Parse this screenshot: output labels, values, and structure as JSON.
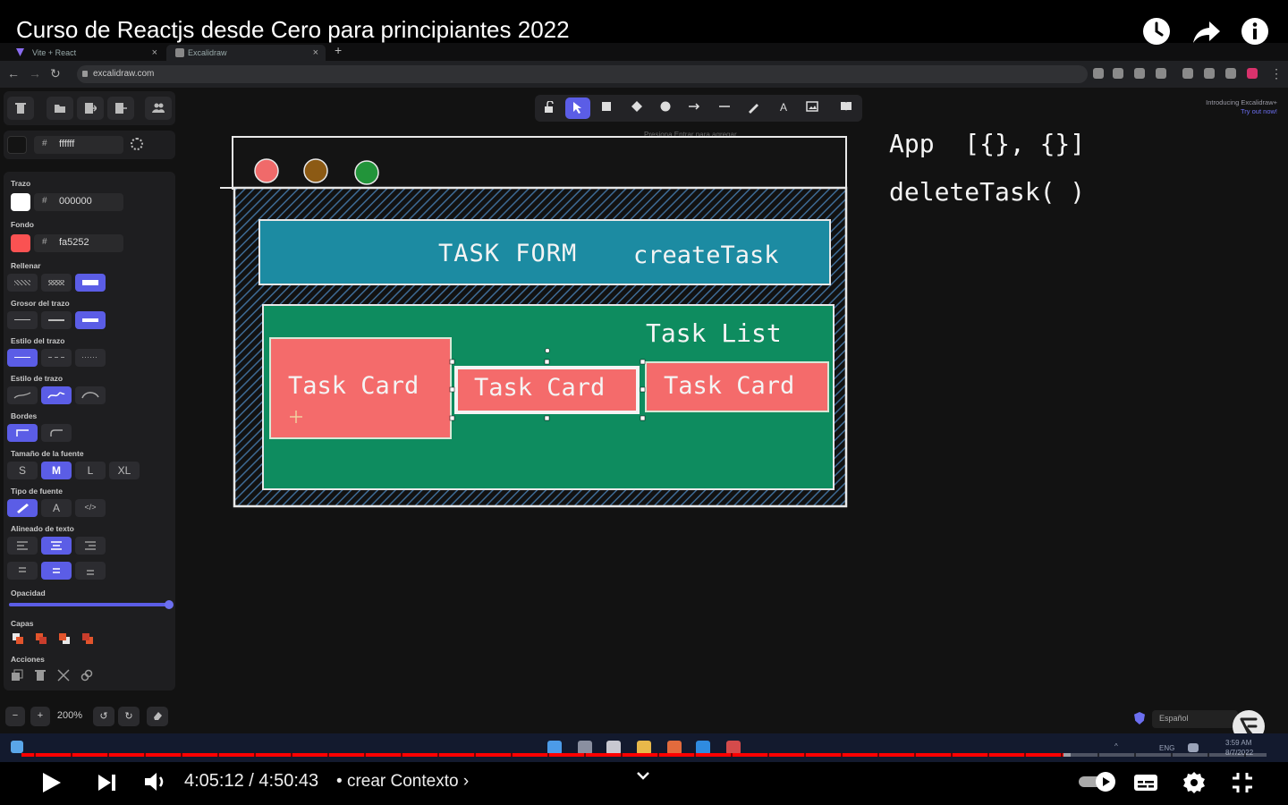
{
  "video": {
    "title": "Curso de Reactjs desde Cero para principiantes 2022",
    "time_current": "4:05:12",
    "time_separator": "/",
    "time_total": "4:50:43",
    "chapter_bullet": "•",
    "chapter_title": "crear Contexto",
    "chapter_arrow": "›",
    "progress": 0.837,
    "buffered": 0.843
  },
  "browser": {
    "tabs": [
      {
        "label": "Vite + React",
        "close": "×"
      },
      {
        "label": "Excalidraw",
        "close": "×"
      }
    ],
    "new_tab": "+",
    "url": "excalidraw.com"
  },
  "excalidraw": {
    "hint": "Presiona Entrar para agregar",
    "intro_line1": "Introducing Excalidraw+",
    "intro_line2": "Try out now!",
    "canvas_bg_hex": "ffffff",
    "stroke": {
      "label": "Trazo",
      "hex": "000000",
      "color": "#ffffff"
    },
    "background": {
      "label": "Fondo",
      "hex": "fa5252",
      "color": "#fa5252"
    },
    "fill_label": "Rellenar",
    "stroke_width_label": "Grosor del trazo",
    "stroke_style_label": "Estilo del trazo",
    "sloppiness_label": "Estilo de trazo",
    "edges_label": "Bordes",
    "font_size_label": "Tamaño de la fuente",
    "font_sizes": [
      "S",
      "M",
      "L",
      "XL"
    ],
    "font_family_label": "Tipo de fuente",
    "font_family_text": "A",
    "font_family_code": "</>",
    "text_align_label": "Alineado de texto",
    "opacity_label": "Opacidad",
    "opacity": 1.0,
    "layers_label": "Capas",
    "actions_label": "Acciones",
    "zoom": {
      "minus": "−",
      "plus": "+",
      "level": "200%"
    },
    "language": "Español",
    "tool_text": "A",
    "shapes": {
      "task_form": "TASK FORM",
      "create_task": "createTask",
      "task_list": "Task List",
      "task_card": "Task Card",
      "note_line1": "App  [{}, {}]",
      "note_line2": "deleteTask( )"
    }
  },
  "taskbar": {
    "lang": "ENG",
    "time": "3:59 AM",
    "date": "8/7/2022"
  },
  "colors": {
    "accent": "#5b5de6",
    "youtube_red": "#ff0000",
    "task_form_fill": "#1c8ba2",
    "task_list_fill": "#0e8c5f",
    "task_card_fill": "#f46b6b",
    "dot_red": "#f06a6a",
    "dot_brown": "#8c5a14",
    "dot_green": "#22943a"
  }
}
